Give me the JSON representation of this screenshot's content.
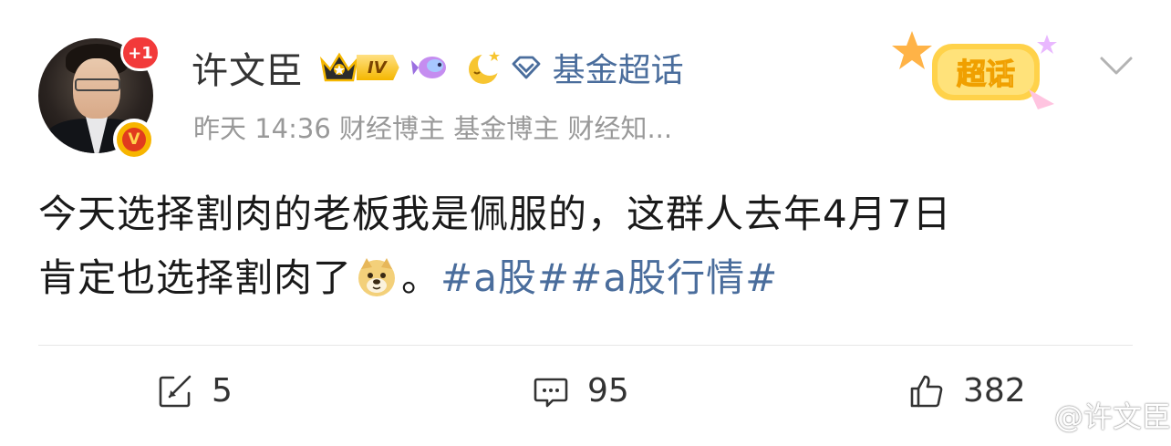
{
  "post": {
    "author": {
      "name": "许文臣",
      "notification_badge": "+1",
      "vip_level": "IV",
      "verified_mark": "V"
    },
    "topic_link": "基金超话",
    "meta": "昨天 14:36  财经博主 基金博主 财经知...",
    "sticker_text": "超话",
    "content": {
      "line1": "今天选择割肉的老板我是佩服的，这群人去年4月7日",
      "line2_text": "肯定也选择割肉了",
      "line2_punct": "。",
      "hashtags": "#a股##a股行情#"
    },
    "actions": {
      "repost_count": "5",
      "comment_count": "95",
      "like_count": "382"
    },
    "watermark": "@许文臣"
  },
  "colors": {
    "link": "#4a6d9c",
    "meta": "#999999",
    "text": "#1a1a1a",
    "badge_red": "#f23a3a",
    "vip_gold": "#f5b700"
  },
  "icons": {
    "crown": "crown-icon",
    "fish": "fish-emoji-icon",
    "moon": "moon-emoji-icon",
    "diamond": "diamond-icon",
    "chevron": "chevron-down-icon",
    "repost": "repost-icon",
    "comment": "comment-icon",
    "like": "thumbs-up-icon",
    "dog": "doge-emoji-icon",
    "weibo": "weibo-logo-icon"
  }
}
